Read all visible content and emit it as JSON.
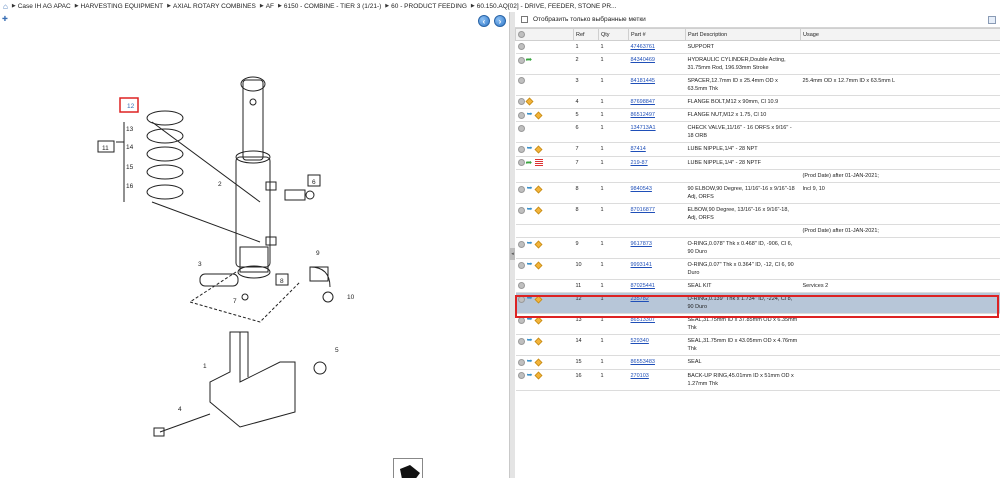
{
  "breadcrumb": {
    "items": [
      "Case IH AG APAC",
      "HARVESTING EQUIPMENT",
      "AXIAL ROTARY COMBINES",
      "AF",
      "6150 - COMBINE - TIER 3 (1/21-)",
      "60 - PRODUCT FEEDING",
      "60.150.AQ[02] - DRIVE, FEEDER, STONE PR..."
    ]
  },
  "filter": {
    "label": "Отобразить только выбранные метки"
  },
  "table": {
    "headers": [
      "Ref",
      "Qty",
      "Part #",
      "Part Description",
      "Usage"
    ],
    "rows": [
      {
        "ref": "1",
        "qty": "1",
        "part": "47463761",
        "desc": "SUPPORT",
        "usage": "",
        "icons": [
          "circle"
        ]
      },
      {
        "ref": "2",
        "qty": "1",
        "part": "84340469",
        "desc": "HYDRAULIC CYLINDER,Double Acting, 31.75mm Rod, 196.93mm Stroke",
        "usage": "",
        "icons": [
          "circle",
          "green-arrow"
        ]
      },
      {
        "ref": "3",
        "qty": "1",
        "part": "84181445",
        "desc": "SPACER,12.7mm ID x 25.4mm OD x 63.5mm Thk",
        "usage": "25.4mm OD x 12.7mm ID x 63.5mm L",
        "icons": [
          "circle"
        ]
      },
      {
        "ref": "4",
        "qty": "1",
        "part": "87698847",
        "desc": "FLANGE BOLT,M12 x 90mm, Cl 10.9",
        "usage": "",
        "icons": [
          "circle",
          "box"
        ]
      },
      {
        "ref": "5",
        "qty": "1",
        "part": "86512497",
        "desc": "FLANGE NUT,M12 x 1.75, Cl 10",
        "usage": "",
        "icons": [
          "circle",
          "arrow",
          "box"
        ]
      },
      {
        "ref": "6",
        "qty": "1",
        "part": "134713A1",
        "desc": "CHECK VALVE,11/16\" - 16 ORFS x 9/16\" - 18 ORB",
        "usage": "",
        "icons": [
          "circle"
        ]
      },
      {
        "ref": "7",
        "qty": "1",
        "part": "87414",
        "desc": "LUBE NIPPLE,1/4\" - 28 NPT",
        "usage": "",
        "icons": [
          "circle",
          "arrow",
          "box"
        ]
      },
      {
        "ref": "7",
        "qty": "1",
        "part": "219-87",
        "desc": "LUBE NIPPLE,1/4\" - 28 NPTF",
        "usage": "",
        "icons": [
          "circle",
          "green-arrow",
          "list"
        ]
      },
      {
        "ref": "",
        "qty": "",
        "part": "",
        "desc": "",
        "usage": "(Prod Date) after 01-JAN-2021;",
        "icons": []
      },
      {
        "ref": "8",
        "qty": "1",
        "part": "9840543",
        "desc": "90 ELBOW,90 Degree, 11/16\"-16 x 9/16\"-18 Adj, ORFS",
        "usage": "Incl 9, 10",
        "icons": [
          "circle",
          "arrow",
          "box"
        ]
      },
      {
        "ref": "8",
        "qty": "1",
        "part": "87016877",
        "desc": "ELBOW,90 Degree, 13/16\"-16 x 9/16\"-18, Adj, ORFS",
        "usage": "",
        "icons": [
          "circle",
          "arrow",
          "box"
        ]
      },
      {
        "ref": "",
        "qty": "",
        "part": "",
        "desc": "",
        "usage": "(Prod Date) after 01-JAN-2021;",
        "icons": []
      },
      {
        "ref": "9",
        "qty": "1",
        "part": "9617873",
        "desc": "O-RING,0.078\" Thk x 0.468\" ID, -906, Cl 6, 90 Duro",
        "usage": "",
        "icons": [
          "circle",
          "arrow",
          "box"
        ]
      },
      {
        "ref": "10",
        "qty": "1",
        "part": "9993141",
        "desc": "O-RING,0.07\" Thk x 0.364\" ID, -12, Cl 6, 90 Duro",
        "usage": "",
        "icons": [
          "circle",
          "arrow",
          "box"
        ]
      },
      {
        "ref": "11",
        "qty": "1",
        "part": "87025441",
        "desc": "SEAL KIT",
        "usage": "Services 2",
        "icons": [
          "circle"
        ]
      },
      {
        "ref": "12",
        "qty": "1",
        "part": "235782",
        "desc": "O-RING,0.139\" Thk x 1.734\" ID, -224, Cl 8, 90 Duro",
        "usage": "",
        "icons": [
          "circle",
          "arrow",
          "box"
        ],
        "selected": true
      },
      {
        "ref": "13",
        "qty": "1",
        "part": "86513307",
        "desc": "SEAL,31.75mm ID x 37.85mm OD x 6.35mm Thk",
        "usage": "",
        "icons": [
          "circle",
          "arrow",
          "box"
        ]
      },
      {
        "ref": "14",
        "qty": "1",
        "part": "529340",
        "desc": "SEAL,31.75mm ID x 43.05mm OD x 4.76mm Thk",
        "usage": "",
        "icons": [
          "circle",
          "arrow",
          "box"
        ]
      },
      {
        "ref": "15",
        "qty": "1",
        "part": "86553483",
        "desc": "SEAL",
        "usage": "",
        "icons": [
          "circle",
          "arrow",
          "box"
        ]
      },
      {
        "ref": "16",
        "qty": "1",
        "part": "270103",
        "desc": "BACK-UP RING,45.01mm ID x 51mm OD x 1.27mm Thk",
        "usage": "",
        "icons": [
          "circle",
          "arrow",
          "box"
        ]
      }
    ]
  },
  "diagram": {
    "callouts": [
      "12",
      "13",
      "14",
      "15",
      "16",
      "11",
      "2",
      "6",
      "3",
      "9",
      "8",
      "7",
      "10",
      "5",
      "1",
      "4"
    ]
  }
}
